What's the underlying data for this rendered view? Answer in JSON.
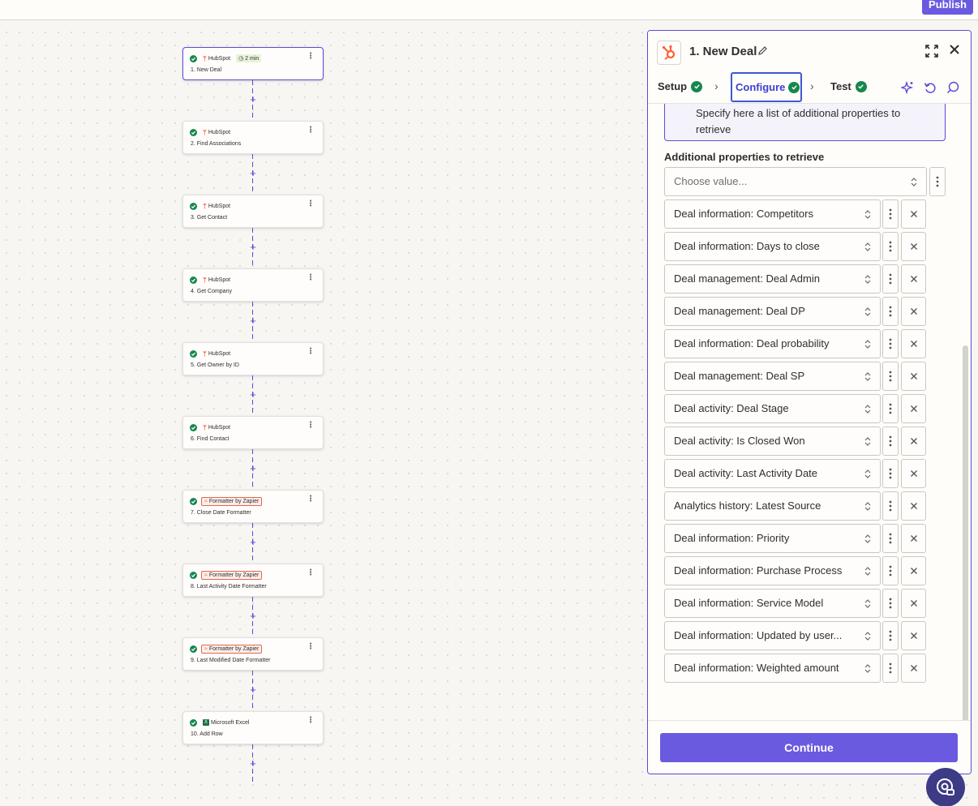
{
  "topbar": {
    "publish_label": "Publish"
  },
  "flow": {
    "steps": [
      {
        "app": "HubSpot",
        "title": "1. New Deal",
        "badge": "2 min",
        "kind": "hubspot"
      },
      {
        "app": "HubSpot",
        "title": "2. Find Associations",
        "kind": "hubspot"
      },
      {
        "app": "HubSpot",
        "title": "3. Get Contact",
        "kind": "hubspot"
      },
      {
        "app": "HubSpot",
        "title": "4. Get Company",
        "kind": "hubspot"
      },
      {
        "app": "HubSpot",
        "title": "5. Get Owner by ID",
        "kind": "hubspot"
      },
      {
        "app": "HubSpot",
        "title": "6. Find Contact",
        "kind": "hubspot"
      },
      {
        "app": "Formatter by Zapier",
        "title": "7. Close Date Formatter",
        "kind": "formatter"
      },
      {
        "app": "Formatter by Zapier",
        "title": "8. Last Activity Date Formatter",
        "kind": "formatter"
      },
      {
        "app": "Formatter by Zapier",
        "title": "9. Last Modified Date Formatter",
        "kind": "formatter"
      },
      {
        "app": "Microsoft Excel",
        "title": "10. Add Row",
        "kind": "excel"
      }
    ],
    "plus": "+"
  },
  "panel": {
    "title": "1. New Deal",
    "tabs": {
      "setup": "Setup",
      "configure": "Configure",
      "test": "Test"
    },
    "help_text": "Specify here a list of additional properties to retrieve",
    "field_label": "Additional properties to retrieve",
    "placeholder": "Choose value...",
    "values": [
      "Deal information: Competitors",
      "Deal information: Days to close",
      "Deal management: Deal Admin",
      "Deal management: Deal DP",
      "Deal information: Deal probability",
      "Deal management: Deal SP",
      "Deal activity: Deal Stage",
      "Deal activity: Is Closed Won",
      "Deal activity: Last Activity Date",
      "Analytics history: Latest Source",
      "Deal information: Priority",
      "Deal information: Purchase Process",
      "Deal information: Service Model",
      "Deal information: Updated by user...",
      "Deal information: Weighted amount"
    ],
    "continue_label": "Continue"
  },
  "colors": {
    "accent": "#6a5ae0",
    "success": "#16874e",
    "hubspot": "#ff5c35",
    "formatter": "#e2694f",
    "excel": "#1d7044"
  }
}
